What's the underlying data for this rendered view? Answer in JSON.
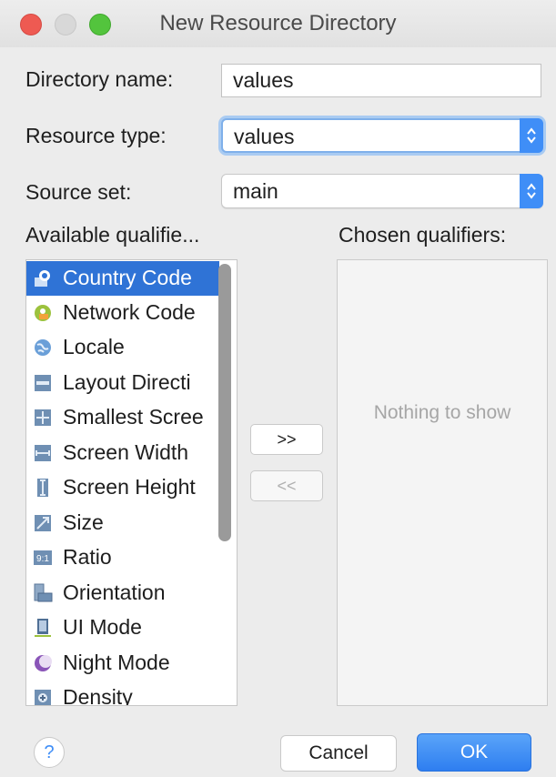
{
  "window": {
    "title": "New Resource Directory"
  },
  "form": {
    "directory_name_label": "Directory name:",
    "directory_name_value": "values",
    "resource_type_label": "Resource type:",
    "resource_type_value": "values",
    "source_set_label": "Source set:",
    "source_set_value": "main"
  },
  "available": {
    "label": "Available qualifie...",
    "items": [
      {
        "label": "Country Code",
        "icon": "country-code-icon",
        "selected": true
      },
      {
        "label": "Network Code",
        "icon": "network-code-icon"
      },
      {
        "label": "Locale",
        "icon": "globe-icon"
      },
      {
        "label": "Layout Directi",
        "icon": "layout-direction-icon"
      },
      {
        "label": "Smallest Scree",
        "icon": "smallest-screen-icon"
      },
      {
        "label": "Screen Width",
        "icon": "screen-width-icon"
      },
      {
        "label": "Screen Height",
        "icon": "screen-height-icon"
      },
      {
        "label": "Size",
        "icon": "size-icon"
      },
      {
        "label": "Ratio",
        "icon": "ratio-icon"
      },
      {
        "label": "Orientation",
        "icon": "orientation-icon"
      },
      {
        "label": "UI Mode",
        "icon": "ui-mode-icon"
      },
      {
        "label": "Night Mode",
        "icon": "night-mode-icon"
      },
      {
        "label": "Density",
        "icon": "density-icon"
      }
    ]
  },
  "buttons": {
    "add": ">>",
    "remove": "<<",
    "help": "?",
    "cancel": "Cancel",
    "ok": "OK"
  },
  "chosen": {
    "label": "Chosen qualifiers:",
    "empty_text": "Nothing to show"
  },
  "colors": {
    "accent": "#3f8ef7",
    "selection": "#2f73d6"
  }
}
